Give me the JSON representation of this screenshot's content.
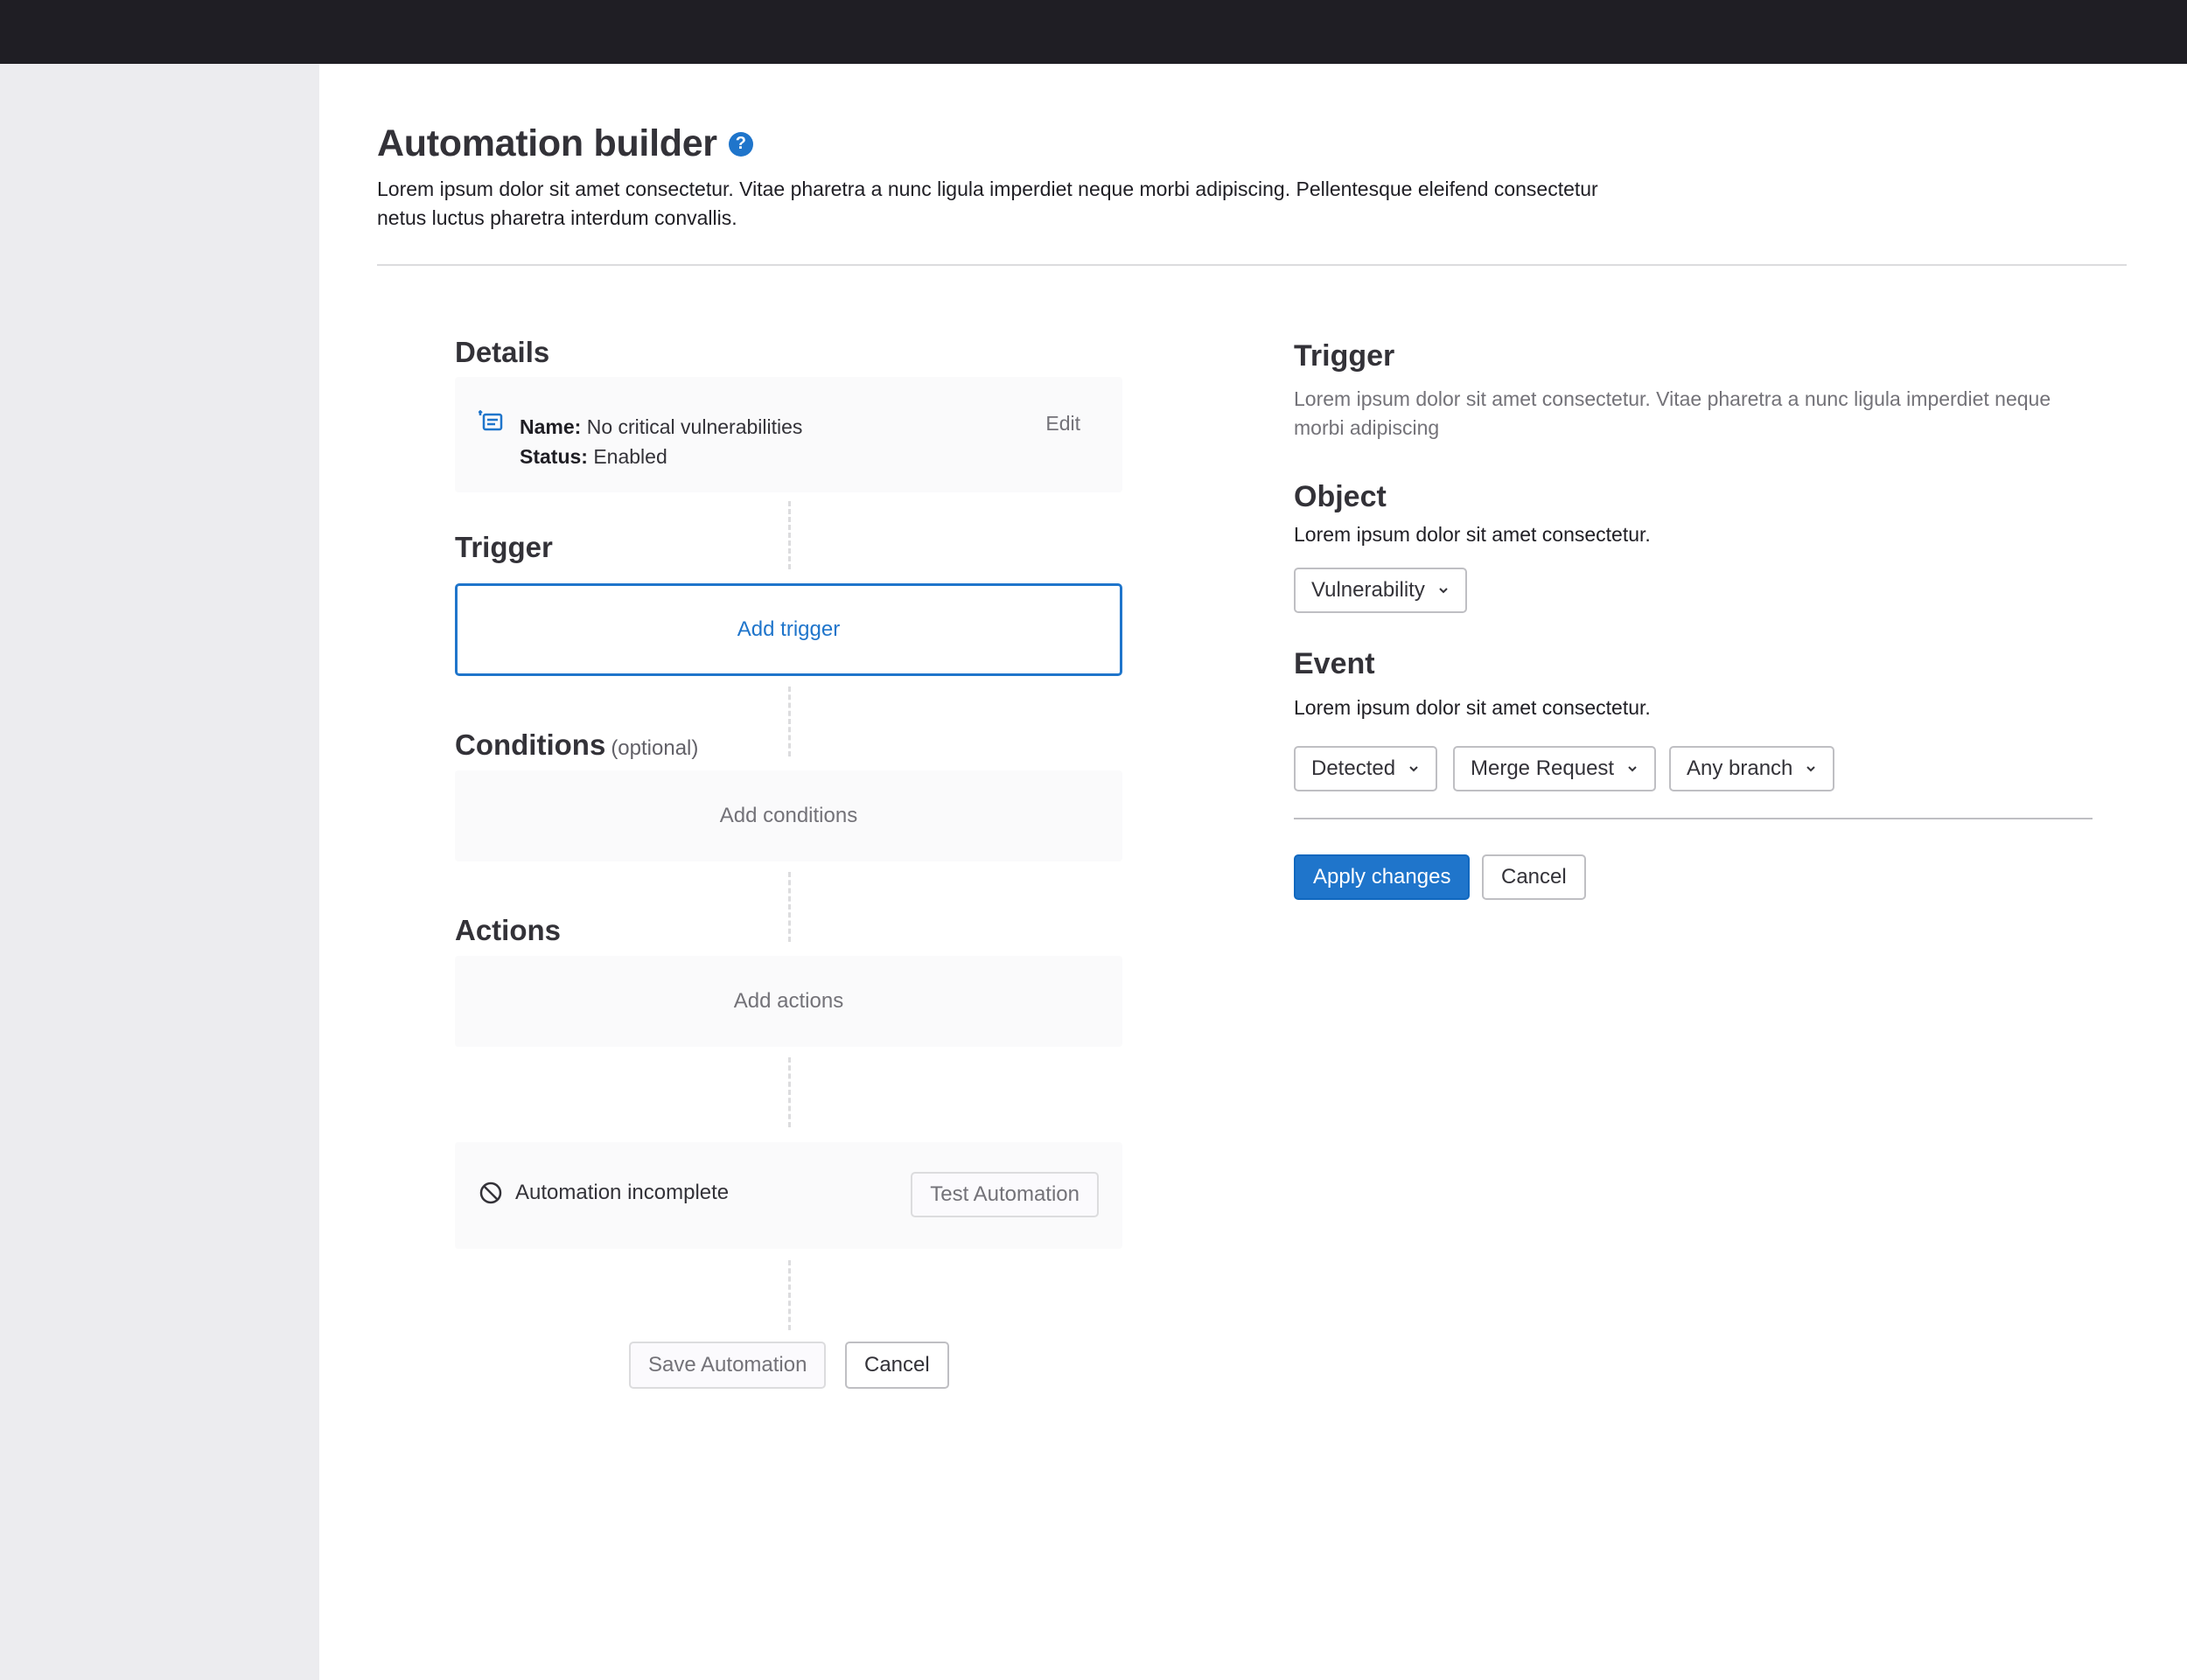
{
  "page": {
    "title": "Automation builder",
    "help_icon": "question-circle-icon",
    "description": "Lorem ipsum dolor sit amet consectetur. Vitae pharetra a nunc ligula imperdiet neque morbi adipiscing. Pellentesque eleifend consectetur netus luctus pharetra interdum convallis."
  },
  "builder": {
    "details": {
      "heading": "Details",
      "icon": "list-task-icon",
      "name_label": "Name:",
      "name_value": "No critical vulnerabilities",
      "status_label": "Status:",
      "status_value": "Enabled",
      "edit_label": "Edit"
    },
    "trigger": {
      "heading": "Trigger",
      "add_label": "Add trigger"
    },
    "conditions": {
      "heading": "Conditions",
      "optional_label": "(optional)",
      "add_label": "Add conditions"
    },
    "actions": {
      "heading": "Actions",
      "add_label": "Add actions"
    },
    "status": {
      "icon": "cancel-circle-icon",
      "text": "Automation incomplete",
      "test_button": "Test Automation"
    },
    "footer": {
      "save_button": "Save Automation",
      "cancel_button": "Cancel"
    }
  },
  "panel": {
    "trigger_heading": "Trigger",
    "trigger_description": "Lorem ipsum dolor sit amet consectetur. Vitae pharetra a nunc ligula imperdiet neque morbi adipiscing",
    "object_heading": "Object",
    "object_description": "Lorem ipsum dolor sit amet consectetur.",
    "object_select": "Vulnerability",
    "event_heading": "Event",
    "event_description": "Lorem ipsum dolor sit amet consectetur.",
    "event_selects": [
      "Detected",
      "Merge Request",
      "Any branch"
    ],
    "apply_button": "Apply changes",
    "cancel_button": "Cancel"
  },
  "colors": {
    "accent": "#1f75cb",
    "topbar": "#1f1e24",
    "sidebar": "#ececef"
  }
}
